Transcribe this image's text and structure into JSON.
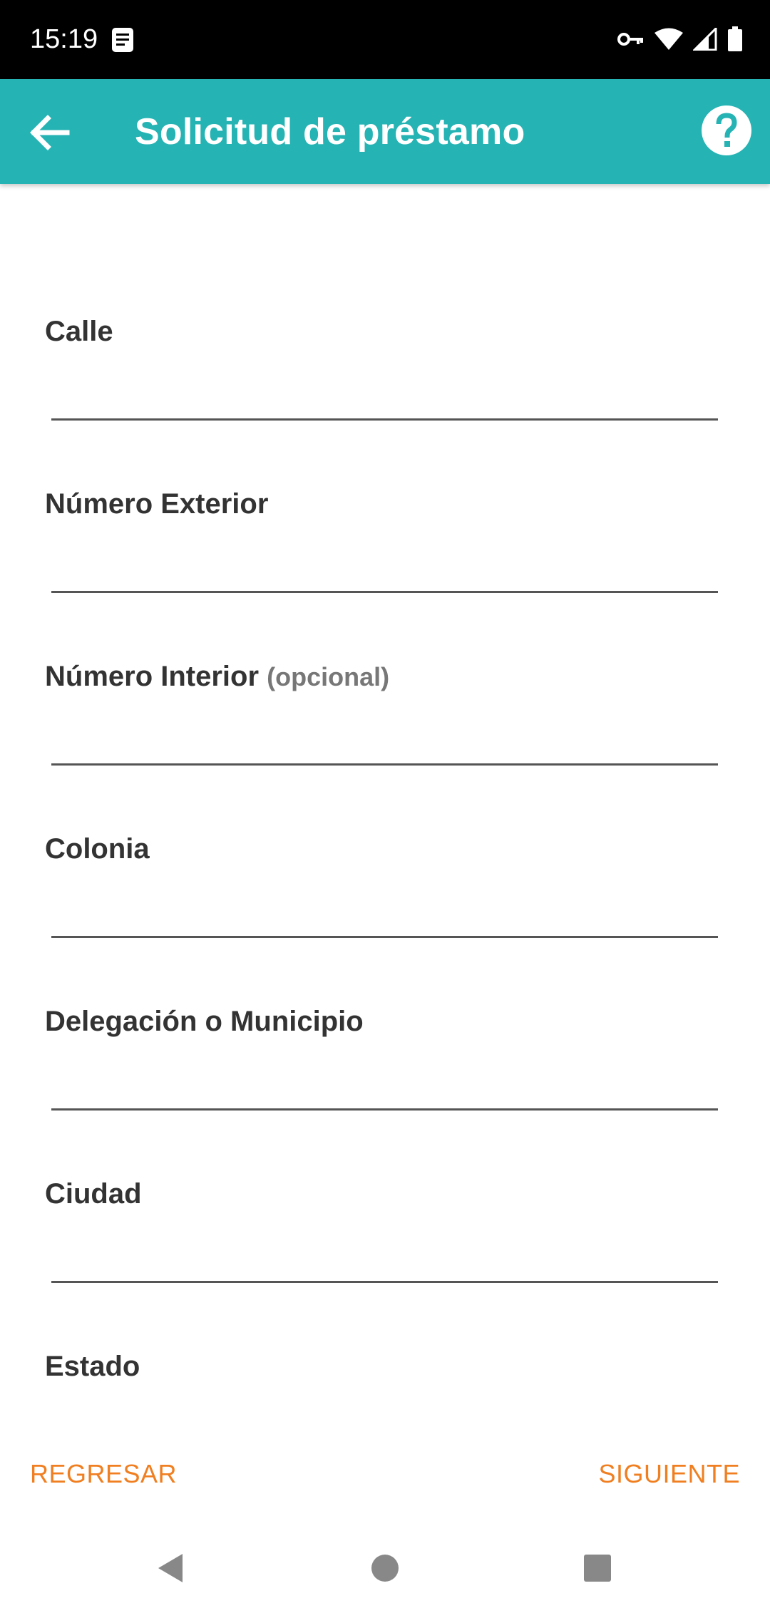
{
  "status_bar": {
    "time": "15:19",
    "icons": [
      "notification-icon",
      "vpn-key-icon",
      "wifi-icon",
      "signal-icon",
      "battery-icon"
    ]
  },
  "app_bar": {
    "title": "Solicitud de préstamo",
    "back_icon": "arrow-back-icon",
    "help_icon": "help-icon",
    "background_color": "#26b3b4"
  },
  "form": {
    "fields": [
      {
        "label": "Calle",
        "hint": "",
        "value": ""
      },
      {
        "label": "Número Exterior",
        "hint": "",
        "value": ""
      },
      {
        "label": "Número Interior",
        "hint": "(opcional)",
        "value": ""
      },
      {
        "label": "Colonia",
        "hint": "",
        "value": ""
      },
      {
        "label": "Delegación o Municipio",
        "hint": "",
        "value": ""
      },
      {
        "label": "Ciudad",
        "hint": "",
        "value": ""
      },
      {
        "label": "Estado",
        "hint": "",
        "value": ""
      }
    ]
  },
  "actions": {
    "back_label": "REGRESAR",
    "next_label": "SIGUIENTE",
    "accent_color": "#f07f21"
  },
  "nav_bar": {
    "icons": [
      "nav-back-icon",
      "nav-home-icon",
      "nav-recents-icon"
    ]
  }
}
